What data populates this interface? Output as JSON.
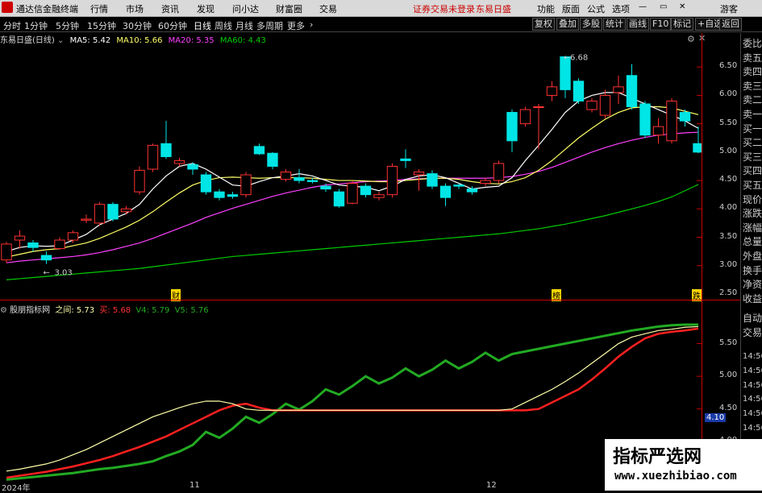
{
  "menubar": {
    "app_title": "通达信金融终端",
    "items": [
      "行情",
      "市场",
      "资讯",
      "发现",
      "问小达",
      "财富圈",
      "交易"
    ],
    "status_text": "证券交易未登录",
    "stock_name": "东易日盛",
    "right_items": [
      "功能",
      "版面",
      "公式",
      "选项"
    ],
    "guest": "游客"
  },
  "toolbar": {
    "periods": [
      "分时",
      "1分钟",
      "5分钟",
      "15分钟",
      "30分钟",
      "60分钟",
      "日线",
      "周线",
      "月线",
      "多周期",
      "更多"
    ],
    "active_period": "日线",
    "right_buttons": [
      "复权",
      "叠加",
      "多股",
      "统计",
      "画线",
      "F10",
      "标记",
      "+自选",
      "返回"
    ]
  },
  "main_legend": {
    "title": "东易日盛(日线)",
    "ma5": "MA5: 5.42",
    "ma10": "MA10: 5.66",
    "ma20": "MA20: 5.35",
    "ma60": "MA60: 4.43"
  },
  "annotations": {
    "high": "6.68",
    "low": "3.03"
  },
  "markers": {
    "m1": "财",
    "m2": "榜",
    "m3": "跌"
  },
  "main_axis": [
    "6.50",
    "6.00",
    "5.50",
    "5.00",
    "4.50",
    "4.00",
    "3.50",
    "3.00",
    "2.50"
  ],
  "sub_legend": {
    "title": "股朋指标网",
    "zhijian": "之间: 5.73",
    "buy": "买: 5.68",
    "v4": "V4: 5.79",
    "v5": "V5: 5.76"
  },
  "sub_axis": [
    "5.50",
    "5.00",
    "4.50",
    "4.00"
  ],
  "sub_tag": "4.10",
  "x_axis": [
    "2024年",
    "11",
    "12"
  ],
  "right_panel": [
    "委比",
    "卖五",
    "卖四",
    "卖三",
    "卖二",
    "卖一",
    "买一",
    "买二",
    "买三",
    "买四",
    "买五",
    "现价",
    "涨跌",
    "涨幅",
    "总量",
    "外盘",
    "换手",
    "净资",
    "收益",
    "自动",
    "交易",
    "14:56",
    "14:56",
    "14:56",
    "14:56",
    "14:56",
    "14:56",
    "14:56",
    "14:56",
    "14:56",
    "14:56"
  ],
  "watermark": {
    "line1": "指标严选网",
    "line2": "www.xuezhibiao.com"
  },
  "colors": {
    "up": "#ff3232",
    "down": "#00e5e5",
    "ma5": "#ffffff",
    "ma10": "#ffff66",
    "ma20": "#ff40ff",
    "ma60": "#00cc00",
    "red_line": "#ff2020",
    "green_line": "#22aa22"
  },
  "chart_data": {
    "type": "candlestick",
    "ylim": [
      2.4,
      6.9
    ],
    "candles": [
      {
        "o": 3.1,
        "c": 3.38,
        "h": 3.42,
        "l": 3.05
      },
      {
        "o": 3.45,
        "c": 3.52,
        "h": 3.62,
        "l": 3.3
      },
      {
        "o": 3.4,
        "c": 3.32,
        "h": 3.45,
        "l": 3.25
      },
      {
        "o": 3.18,
        "c": 3.1,
        "h": 3.25,
        "l": 3.03
      },
      {
        "o": 3.3,
        "c": 3.45,
        "h": 3.5,
        "l": 3.28
      },
      {
        "o": 3.45,
        "c": 3.58,
        "h": 3.62,
        "l": 3.4
      },
      {
        "o": 3.8,
        "c": 3.82,
        "h": 3.9,
        "l": 3.75
      },
      {
        "o": 3.75,
        "c": 4.08,
        "h": 4.12,
        "l": 3.7
      },
      {
        "o": 4.08,
        "c": 3.82,
        "h": 4.12,
        "l": 3.78
      },
      {
        "o": 3.95,
        "c": 4.0,
        "h": 4.05,
        "l": 3.9
      },
      {
        "o": 4.3,
        "c": 4.68,
        "h": 4.75,
        "l": 4.25
      },
      {
        "o": 4.7,
        "c": 5.12,
        "h": 5.15,
        "l": 4.65
      },
      {
        "o": 5.15,
        "c": 4.92,
        "h": 5.55,
        "l": 4.88
      },
      {
        "o": 4.8,
        "c": 4.85,
        "h": 4.9,
        "l": 4.75
      },
      {
        "o": 4.78,
        "c": 4.7,
        "h": 4.82,
        "l": 4.6
      },
      {
        "o": 4.6,
        "c": 4.3,
        "h": 4.65,
        "l": 4.25
      },
      {
        "o": 4.3,
        "c": 4.2,
        "h": 4.35,
        "l": 4.15
      },
      {
        "o": 4.25,
        "c": 4.22,
        "h": 4.3,
        "l": 4.18
      },
      {
        "o": 4.25,
        "c": 4.6,
        "h": 4.65,
        "l": 4.2
      },
      {
        "o": 5.1,
        "c": 4.97,
        "h": 5.15,
        "l": 4.95
      },
      {
        "o": 4.98,
        "c": 4.75,
        "h": 5.0,
        "l": 4.7
      },
      {
        "o": 4.52,
        "c": 4.65,
        "h": 4.7,
        "l": 4.48
      },
      {
        "o": 4.55,
        "c": 4.5,
        "h": 4.7,
        "l": 4.45
      },
      {
        "o": 4.5,
        "c": 4.48,
        "h": 4.55,
        "l": 4.45
      },
      {
        "o": 4.4,
        "c": 4.35,
        "h": 4.45,
        "l": 4.3
      },
      {
        "o": 4.3,
        "c": 4.05,
        "h": 4.35,
        "l": 4.02
      },
      {
        "o": 4.1,
        "c": 4.45,
        "h": 4.5,
        "l": 4.08
      },
      {
        "o": 4.4,
        "c": 4.25,
        "h": 4.45,
        "l": 4.2
      },
      {
        "o": 4.2,
        "c": 4.25,
        "h": 4.3,
        "l": 4.15
      },
      {
        "o": 4.25,
        "c": 4.75,
        "h": 4.8,
        "l": 4.2
      },
      {
        "o": 4.88,
        "c": 4.85,
        "h": 5.05,
        "l": 4.72
      },
      {
        "o": 4.6,
        "c": 4.65,
        "h": 4.7,
        "l": 4.32
      },
      {
        "o": 4.62,
        "c": 4.4,
        "h": 4.68,
        "l": 4.35
      },
      {
        "o": 4.4,
        "c": 4.2,
        "h": 4.45,
        "l": 4.05
      },
      {
        "o": 4.42,
        "c": 4.4,
        "h": 4.45,
        "l": 4.35
      },
      {
        "o": 4.35,
        "c": 4.3,
        "h": 4.4,
        "l": 4.25
      },
      {
        "o": 4.45,
        "c": 4.5,
        "h": 4.55,
        "l": 4.4
      },
      {
        "o": 4.5,
        "c": 4.8,
        "h": 4.85,
        "l": 4.45
      },
      {
        "o": 5.7,
        "c": 5.2,
        "h": 5.75,
        "l": 5.0
      },
      {
        "o": 5.5,
        "c": 5.75,
        "h": 5.8,
        "l": 5.45
      },
      {
        "o": 5.8,
        "c": 5.8,
        "h": 5.85,
        "l": 5.05
      },
      {
        "o": 6.0,
        "c": 6.15,
        "h": 6.25,
        "l": 5.9
      },
      {
        "o": 6.68,
        "c": 6.1,
        "h": 6.68,
        "l": 5.95
      },
      {
        "o": 6.25,
        "c": 5.9,
        "h": 6.3,
        "l": 5.85
      },
      {
        "o": 5.75,
        "c": 5.9,
        "h": 5.95,
        "l": 5.7
      },
      {
        "o": 5.65,
        "c": 6.0,
        "h": 6.1,
        "l": 5.6
      },
      {
        "o": 6.05,
        "c": 6.15,
        "h": 6.35,
        "l": 5.85
      },
      {
        "o": 6.35,
        "c": 5.8,
        "h": 6.55,
        "l": 5.75
      },
      {
        "o": 5.85,
        "c": 5.3,
        "h": 5.9,
        "l": 5.25
      },
      {
        "o": 5.3,
        "c": 5.45,
        "h": 5.6,
        "l": 5.15
      },
      {
        "o": 5.2,
        "c": 5.9,
        "h": 5.95,
        "l": 5.15
      },
      {
        "o": 5.7,
        "c": 5.55,
        "h": 5.75,
        "l": 5.45
      },
      {
        "o": 5.15,
        "c": 5.0,
        "h": 5.45,
        "l": 4.98
      }
    ],
    "ma5": [
      3.25,
      3.32,
      3.35,
      3.34,
      3.35,
      3.45,
      3.55,
      3.72,
      3.82,
      3.92,
      4.08,
      4.35,
      4.58,
      4.75,
      4.8,
      4.7,
      4.56,
      4.42,
      4.4,
      4.48,
      4.55,
      4.58,
      4.62,
      4.58,
      4.5,
      4.42,
      4.4,
      4.38,
      4.32,
      4.4,
      4.52,
      4.58,
      4.6,
      4.55,
      4.45,
      4.35,
      4.38,
      4.4,
      4.55,
      4.85,
      5.12,
      5.4,
      5.7,
      5.9,
      6.0,
      6.05,
      6.05,
      5.95,
      5.85,
      5.75,
      5.65,
      5.55,
      5.42
    ],
    "ma10": [
      3.15,
      3.2,
      3.25,
      3.28,
      3.3,
      3.35,
      3.4,
      3.48,
      3.58,
      3.68,
      3.8,
      3.95,
      4.12,
      4.28,
      4.42,
      4.5,
      4.55,
      4.56,
      4.55,
      4.54,
      4.55,
      4.55,
      4.55,
      4.54,
      4.52,
      4.5,
      4.5,
      4.49,
      4.48,
      4.48,
      4.5,
      4.52,
      4.54,
      4.54,
      4.52,
      4.48,
      4.45,
      4.44,
      4.48,
      4.55,
      4.68,
      4.85,
      5.05,
      5.25,
      5.42,
      5.58,
      5.7,
      5.78,
      5.8,
      5.8,
      5.78,
      5.72,
      5.66
    ],
    "ma20": [
      3.05,
      3.08,
      3.1,
      3.12,
      3.14,
      3.16,
      3.19,
      3.23,
      3.28,
      3.34,
      3.4,
      3.48,
      3.57,
      3.66,
      3.75,
      3.85,
      3.93,
      4.01,
      4.08,
      4.15,
      4.22,
      4.28,
      4.33,
      4.38,
      4.42,
      4.44,
      4.46,
      4.48,
      4.49,
      4.5,
      4.52,
      4.53,
      4.54,
      4.54,
      4.54,
      4.54,
      4.54,
      4.55,
      4.57,
      4.61,
      4.66,
      4.73,
      4.82,
      4.91,
      5.0,
      5.08,
      5.15,
      5.21,
      5.26,
      5.3,
      5.32,
      5.34,
      5.35
    ],
    "ma60": [
      2.75,
      2.77,
      2.79,
      2.81,
      2.83,
      2.85,
      2.87,
      2.89,
      2.91,
      2.93,
      2.95,
      2.98,
      3.01,
      3.04,
      3.07,
      3.1,
      3.13,
      3.16,
      3.18,
      3.2,
      3.22,
      3.24,
      3.26,
      3.28,
      3.3,
      3.32,
      3.34,
      3.36,
      3.38,
      3.4,
      3.42,
      3.44,
      3.46,
      3.48,
      3.5,
      3.52,
      3.54,
      3.56,
      3.59,
      3.62,
      3.65,
      3.69,
      3.73,
      3.78,
      3.83,
      3.88,
      3.94,
      4.0,
      4.06,
      4.13,
      4.21,
      4.32,
      4.43
    ],
    "sub": {
      "ylim": [
        3.4,
        5.95
      ],
      "yellow": [
        3.55,
        3.58,
        3.62,
        3.66,
        3.72,
        3.8,
        3.88,
        3.98,
        4.08,
        4.18,
        4.28,
        4.38,
        4.45,
        4.52,
        4.58,
        4.62,
        4.62,
        4.58,
        4.5,
        4.48,
        4.48,
        4.48,
        4.48,
        4.48,
        4.48,
        4.48,
        4.48,
        4.48,
        4.48,
        4.48,
        4.48,
        4.48,
        4.48,
        4.48,
        4.48,
        4.48,
        4.48,
        4.48,
        4.5,
        4.6,
        4.7,
        4.8,
        4.92,
        5.05,
        5.2,
        5.35,
        5.5,
        5.6,
        5.65,
        5.7,
        5.72,
        5.75,
        5.76
      ],
      "red": [
        3.45,
        3.48,
        3.51,
        3.54,
        3.58,
        3.62,
        3.67,
        3.72,
        3.78,
        3.85,
        3.92,
        4.0,
        4.08,
        4.18,
        4.28,
        4.38,
        4.48,
        4.55,
        4.58,
        4.52,
        4.48,
        4.48,
        4.48,
        4.48,
        4.48,
        4.48,
        4.48,
        4.48,
        4.48,
        4.48,
        4.48,
        4.48,
        4.48,
        4.48,
        4.48,
        4.48,
        4.48,
        4.48,
        4.48,
        4.48,
        4.5,
        4.6,
        4.7,
        4.8,
        4.95,
        5.12,
        5.3,
        5.45,
        5.58,
        5.65,
        5.68,
        5.7,
        5.73
      ],
      "green": [
        3.42,
        3.44,
        3.46,
        3.48,
        3.5,
        3.52,
        3.55,
        3.58,
        3.6,
        3.63,
        3.66,
        3.7,
        3.78,
        3.85,
        3.95,
        4.05,
        4.12,
        4.2,
        4.28,
        4.35,
        4.42,
        4.48,
        4.55,
        4.62,
        4.7,
        4.78,
        4.85,
        4.9,
        4.95,
        4.98,
        5.02,
        5.06,
        5.1,
        5.14,
        5.18,
        5.22,
        5.26,
        5.3,
        5.34,
        5.38,
        5.42,
        5.46,
        5.5,
        5.54,
        5.58,
        5.62,
        5.66,
        5.7,
        5.73,
        5.76,
        5.78,
        5.79,
        5.79
      ]
    }
  }
}
